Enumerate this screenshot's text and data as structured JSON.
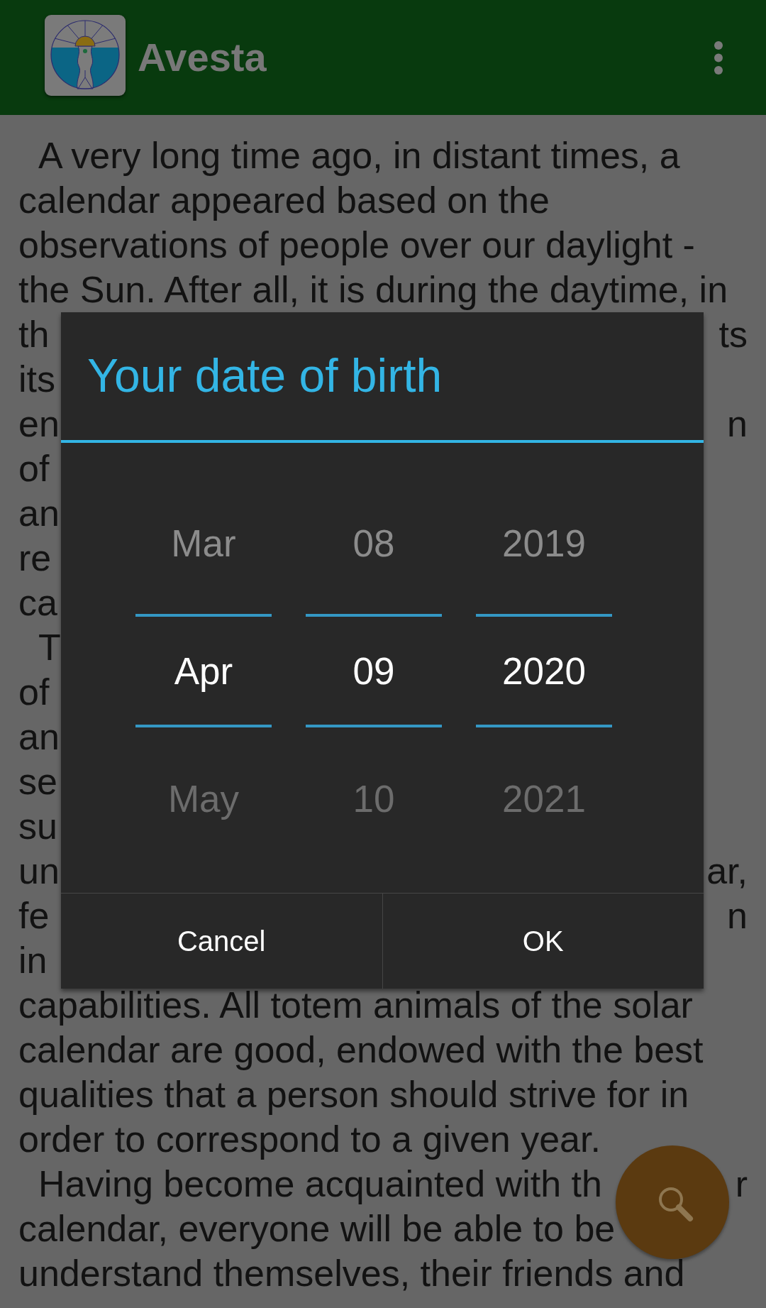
{
  "app_bar": {
    "title": "Avesta"
  },
  "article": {
    "paragraphs": [
      {
        "lines": [
          {
            "text": "A very long time ago, in distant times, a"
          },
          {
            "text": "calendar appeared based on the"
          },
          {
            "text": "observations of people over our daylight -"
          },
          {
            "text": "the Sun. After all, it is during the daytime, in"
          },
          {
            "text": "th",
            "end": "ts"
          },
          {
            "text": "its"
          },
          {
            "text": "en",
            "end": "n"
          },
          {
            "text": "of"
          },
          {
            "text": "an"
          },
          {
            "text": "re"
          },
          {
            "text": "ca"
          }
        ]
      },
      {
        "lines": [
          {
            "text": "T"
          },
          {
            "text": "of"
          },
          {
            "text": "an"
          },
          {
            "text": "se"
          },
          {
            "text": "su"
          },
          {
            "text": "un",
            "end": "ar,"
          },
          {
            "text": "fe",
            "end": "n"
          },
          {
            "text": "in"
          },
          {
            "text": "capabilities. All totem animals of the solar"
          },
          {
            "text": "calendar are good, endowed with the best"
          },
          {
            "text": "qualities that a person should strive for in"
          },
          {
            "text": "order to correspond to a given year."
          }
        ]
      },
      {
        "lines": [
          {
            "text": "Having become acquainted with th",
            "end": "r"
          },
          {
            "text": "calendar, everyone will be able to be"
          },
          {
            "text": "understand themselves, their friends and"
          }
        ]
      }
    ]
  },
  "dialog": {
    "title": "Your date of birth",
    "picker": {
      "columns": [
        {
          "items": [
            {
              "label": "Mar",
              "selected": false
            },
            {
              "label": "Apr",
              "selected": true
            },
            {
              "label": "May",
              "selected": false
            }
          ]
        },
        {
          "items": [
            {
              "label": "08",
              "selected": false
            },
            {
              "label": "09",
              "selected": true
            },
            {
              "label": "10",
              "selected": false
            }
          ]
        },
        {
          "items": [
            {
              "label": "2019",
              "selected": false
            },
            {
              "label": "2020",
              "selected": true
            },
            {
              "label": "2021",
              "selected": false
            }
          ]
        }
      ]
    },
    "buttons": [
      {
        "label": "Cancel"
      },
      {
        "label": "OK"
      }
    ]
  }
}
